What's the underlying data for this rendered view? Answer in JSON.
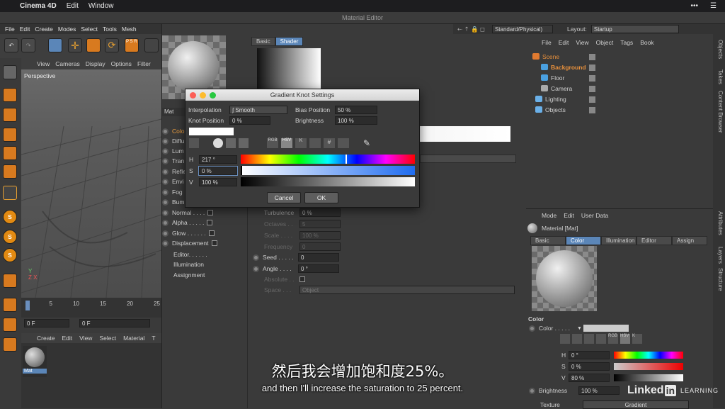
{
  "macbar": {
    "apple": "",
    "app": "Cinema 4D",
    "menus": [
      "Edit",
      "Window"
    ]
  },
  "window_title": "Material Editor",
  "main_menu": [
    "File",
    "Edit",
    "Create",
    "Modes",
    "Select",
    "Tools",
    "Mesh"
  ],
  "viewport": {
    "menu": [
      "View",
      "Cameras",
      "Display",
      "Options",
      "Filter"
    ],
    "label": "Perspective"
  },
  "timeline": {
    "ticks": [
      "0",
      "5",
      "10",
      "15",
      "20",
      "25"
    ],
    "frame1": "0 F",
    "frame2": "0 F"
  },
  "material_manager": {
    "menu": [
      "Create",
      "Edit",
      "View",
      "Select",
      "Material",
      "T"
    ],
    "mat_label": "Mat"
  },
  "mat_editor": {
    "name": "Mat",
    "tabs": [
      "Basic",
      "Shader"
    ],
    "channels": [
      {
        "label": "Color",
        "checked": true
      },
      {
        "label": "Diffusion",
        "checked": false
      },
      {
        "label": "Luminance",
        "checked": false
      },
      {
        "label": "Transparency",
        "checked": false
      },
      {
        "label": "Reflectance",
        "checked": true
      },
      {
        "label": "Environment",
        "checked": false
      },
      {
        "label": "Fog",
        "checked": false
      },
      {
        "label": "Bump",
        "checked": false
      },
      {
        "label": "Normal",
        "checked": false
      },
      {
        "label": "Alpha",
        "checked": false
      },
      {
        "label": "Glow",
        "checked": false
      },
      {
        "label": "Displacement",
        "checked": false
      }
    ],
    "channel_labels_visible": [
      "Colo",
      "Diffu",
      "Lum",
      "Tran",
      "Refle",
      "Envi",
      "Fog",
      "Bum",
      "Normal . . . .",
      "Alpha . . . . .",
      "Glow . . . . . .",
      "Displacement"
    ],
    "extra": [
      "Editor. . . . . .",
      "Illumination",
      "Assignment"
    ],
    "params": [
      {
        "label": "Turbulence",
        "value": "0 %"
      },
      {
        "label": "Octaves . .",
        "value": "5"
      },
      {
        "label": "Scale . . . .",
        "value": "100 %"
      },
      {
        "label": "Frequency",
        "value": "0"
      },
      {
        "label": "Seed . . . . .",
        "value": "0"
      },
      {
        "label": "Angle . . . .",
        "value": "0 °"
      },
      {
        "label": "Absolute . .",
        "value": ""
      },
      {
        "label": "Space . . .",
        "value": "Object"
      }
    ]
  },
  "dialog": {
    "title": "Gradient Knot Settings",
    "interpolation_label": "Interpolation",
    "interpolation_value": "Smooth",
    "knot_position_label": "Knot Position",
    "knot_position_value": "0 %",
    "bias_label": "Bias Position",
    "bias_value": "50 %",
    "brightness_label": "Brightness",
    "brightness_value": "100 %",
    "modes": [
      "RGB",
      "HSV",
      "K",
      "#"
    ],
    "h_label": "H",
    "h_value": "217 °",
    "s_label": "S",
    "s_value": "0 %",
    "v_label": "V",
    "v_value": "100 %",
    "cancel": "Cancel",
    "ok": "OK"
  },
  "top_right": {
    "renderer": "Standard/Physical)",
    "layout_label": "Layout:",
    "layout_value": "Startup"
  },
  "object_manager": {
    "menu": [
      "File",
      "Edit",
      "View",
      "Object",
      "Tags",
      "Book"
    ],
    "objects": [
      "Scene",
      "Background",
      "Floor",
      "Camera",
      "Lighting",
      "Objects"
    ]
  },
  "attributes": {
    "menu": [
      "Mode",
      "Edit",
      "User Data"
    ],
    "title": "Material [Mat]",
    "tabs": [
      "Basic",
      "Color",
      "Illumination",
      "Editor",
      "Assign"
    ],
    "section": "Color",
    "color_label": "Color . . . . .",
    "modes": [
      "RGB",
      "HSV",
      "K"
    ],
    "h": "0 °",
    "s": "0 %",
    "v": "80 %",
    "h_label": "H",
    "s_label": "S",
    "v_label": "V",
    "brightness_label": "Brightness",
    "brightness_value": "100 %",
    "texture_label": "Texture",
    "texture_value": "Gradient"
  },
  "side_tabs": [
    "Objects",
    "Takes",
    "Content Browser",
    "Attributes",
    "Layers",
    "Structure"
  ],
  "watermark": {
    "brand": "Linked",
    "in": "in",
    "learning": "LEARNING"
  },
  "subtitle": {
    "zh": "然后我会增加饱和度25%。",
    "en": "and then I'll increase the saturation to 25 percent."
  }
}
